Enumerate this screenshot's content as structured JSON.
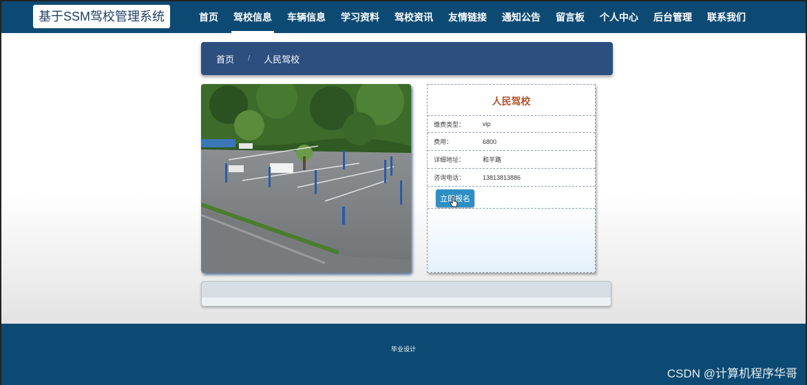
{
  "brand": {
    "title": "基于SSM驾校管理系统"
  },
  "nav": {
    "active_index": 1,
    "items": [
      "首页",
      "驾校信息",
      "车辆信息",
      "学习资料",
      "驾校资讯",
      "友情链接",
      "通知公告",
      "留言板",
      "个人中心",
      "后台管理",
      "联系我们"
    ]
  },
  "breadcrumb": {
    "home": "首页",
    "separator": "/",
    "current": "人民驾校"
  },
  "school": {
    "name": "人民驾校",
    "fields": [
      {
        "label": "缴费类型：",
        "value": "vip"
      },
      {
        "label": "费用：",
        "value": "6800"
      },
      {
        "label": "详细地址：",
        "value": "和平路"
      },
      {
        "label": "咨询电话：",
        "value": "13813813886"
      }
    ],
    "signup_label": "立即报名"
  },
  "footer": {
    "text": "毕业设计"
  },
  "watermark": {
    "text": "CSDN @计算机程序华哥"
  },
  "colors": {
    "header_bg": "#0d4a73",
    "crumb_bg": "#2c4f80",
    "accent": "#2f8fc4",
    "title": "#b0532e"
  }
}
